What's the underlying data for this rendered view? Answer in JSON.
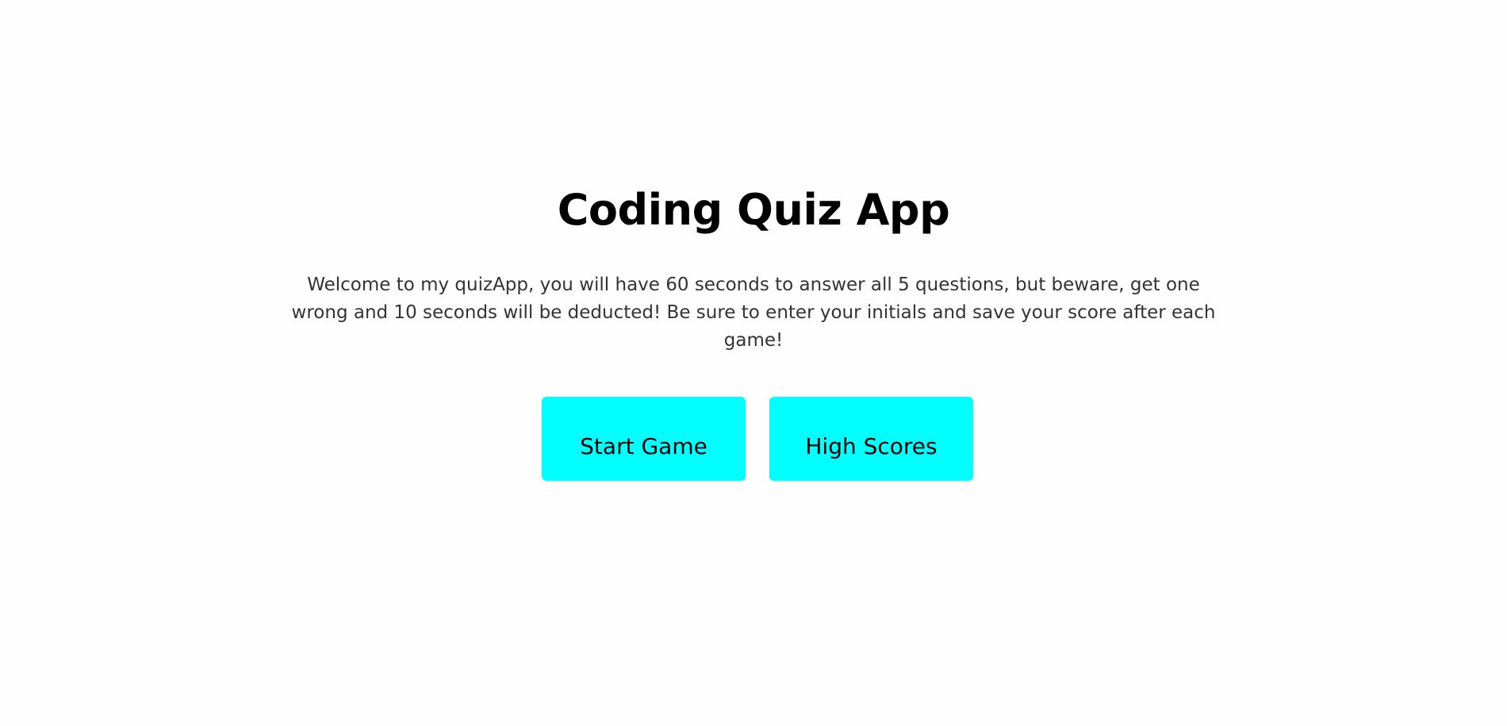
{
  "header": {
    "title": "Coding Quiz App"
  },
  "intro": {
    "text": "Welcome to my quizApp, you will have 60 seconds to answer all 5 questions, but beware, get one wrong and 10 seconds will be deducted! Be sure to enter your initials and save your score after each game!"
  },
  "actions": {
    "start_label": "Start Game",
    "scores_label": "High Scores"
  },
  "colors": {
    "button_background": "#00ffff",
    "page_background": "#fefefe",
    "title_color": "#000000",
    "text_color": "#333333"
  }
}
